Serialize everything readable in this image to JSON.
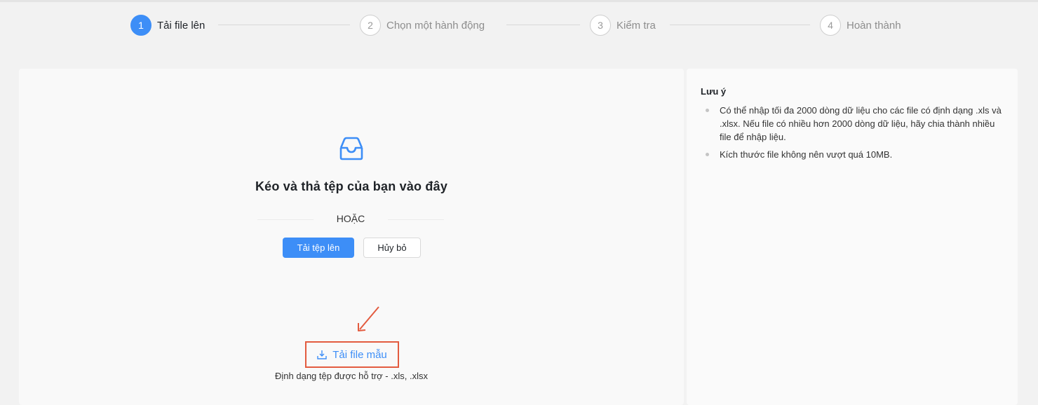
{
  "stepper": {
    "steps": [
      {
        "number": "1",
        "label": "Tải file lên",
        "active": true
      },
      {
        "number": "2",
        "label": "Chọn một hành động",
        "active": false
      },
      {
        "number": "3",
        "label": "Kiểm tra",
        "active": false
      },
      {
        "number": "4",
        "label": "Hoàn thành",
        "active": false
      }
    ]
  },
  "upload": {
    "icon": "inbox-icon",
    "title": "Kéo và thả tệp của bạn vào đây",
    "or_text": "HOẶC",
    "upload_button": "Tải tệp lên",
    "cancel_button": "Hủy bỏ",
    "download_template": "Tải file mẫu",
    "download_icon": "download-icon",
    "supported_formats": "Định dạng tệp được hỗ trợ - .xls, .xlsx"
  },
  "notes": {
    "title": "Lưu ý",
    "items": [
      "Có thể nhập tối đa 2000 dòng dữ liệu cho các file có định dạng .xls và .xlsx. Nếu file có nhiều hơn 2000 dòng dữ liệu, hãy chia thành nhiều file để nhập liệu.",
      "Kích thước file không nên vượt quá 10MB."
    ]
  },
  "colors": {
    "accent": "#3d8ef7",
    "annotation": "#e35b3f",
    "background": "#f2f2f2"
  }
}
